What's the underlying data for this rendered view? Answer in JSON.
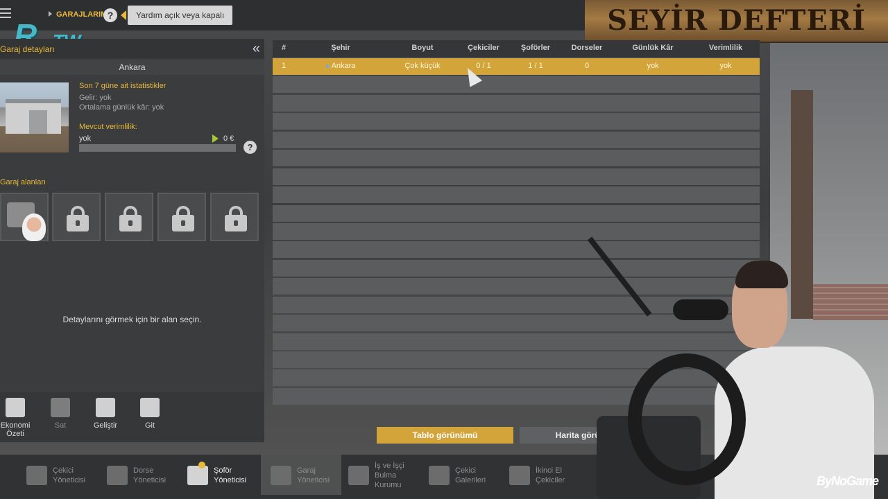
{
  "topbar": {
    "breadcrumb": "GARAJLARIM",
    "help_tooltip": "Yardım açık veya kapalı"
  },
  "branding": {
    "logo_main": "R",
    "logo_sub": "TW",
    "banner": "SEYİR DEFTERİ",
    "watermark": "ByNoGame"
  },
  "left_panel": {
    "title": "Garaj detayları",
    "city": "Ankara",
    "stats_title": "Son 7 güne ait istatistikler",
    "income": "Gelir: yok",
    "avg_profit": "Ortalama günlük kâr: yok",
    "efficiency_title": "Mevcut verimlilik:",
    "efficiency_value": "yok",
    "efficiency_money": "0 €",
    "efficiency_level": 0.0,
    "slots_title": "Garaj alanları",
    "slots": [
      {
        "state": "occupied"
      },
      {
        "state": "locked"
      },
      {
        "state": "locked"
      },
      {
        "state": "locked"
      },
      {
        "state": "locked"
      }
    ],
    "hint": "Detaylarını görmek için bir alan seçin.",
    "actions": [
      {
        "label": "Ekonomi\nÖzeti",
        "icon": "economy-icon",
        "enabled": true
      },
      {
        "label": "Sat",
        "icon": "sell-icon",
        "enabled": false
      },
      {
        "label": "Geliştir",
        "icon": "upgrade-icon",
        "enabled": true
      },
      {
        "label": "Git",
        "icon": "goto-icon",
        "enabled": true
      }
    ]
  },
  "table": {
    "columns": [
      "#",
      "Şehir",
      "Boyut",
      "Çekiciler",
      "Şoförler",
      "Dorseler",
      "Günlük Kâr",
      "Verimlilik"
    ],
    "rows": [
      [
        "1",
        "Ankara",
        "Çok küçük",
        "0 / 1",
        "1 / 1",
        "0",
        "yok",
        "yok"
      ]
    ],
    "empty_rows": 18
  },
  "view_buttons": {
    "table": "Tablo görünümü",
    "map": "Harita görünümü"
  },
  "bottom_nav": [
    {
      "label": "Çekici\nYöneticisi",
      "icon": "truck-manager-icon",
      "active": false,
      "on": false
    },
    {
      "label": "Dorse\nYöneticisi",
      "icon": "trailer-manager-icon",
      "active": false,
      "on": false
    },
    {
      "label": "Şoför\nYöneticisi",
      "icon": "driver-manager-icon",
      "active": false,
      "on": true,
      "badge": true
    },
    {
      "label": "Garaj\nYöneticisi",
      "icon": "garage-manager-icon",
      "active": true,
      "on": false
    },
    {
      "label": "İş ve İşçi\nBulma\nKurumu",
      "icon": "employment-agency-icon",
      "active": false,
      "on": false
    },
    {
      "label": "Çekici\nGalerileri",
      "icon": "truck-dealer-icon",
      "active": false,
      "on": false
    },
    {
      "label": "İkinci El\nÇekiciler",
      "icon": "used-trucks-icon",
      "active": false,
      "on": false
    }
  ],
  "colors": {
    "accent": "#d3a43a",
    "highlight_text": "#e8b93a"
  }
}
